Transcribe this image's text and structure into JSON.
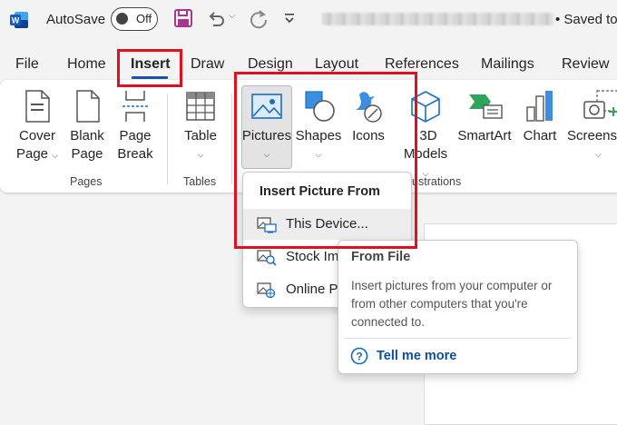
{
  "titlebar": {
    "autosave_label": "AutoSave",
    "toggle_state": "Off",
    "saved_text": "• Saved to"
  },
  "tabs": [
    "File",
    "Home",
    "Insert",
    "Draw",
    "Design",
    "Layout",
    "References",
    "Mailings",
    "Review"
  ],
  "active_tab": "Insert",
  "ribbon": {
    "cover_page": [
      "Cover",
      "Page"
    ],
    "blank_page": [
      "Blank",
      "Page"
    ],
    "page_break": [
      "Page",
      "Break"
    ],
    "table": "Table",
    "pictures": "Pictures",
    "shapes": "Shapes",
    "icons": "Icons",
    "models_3d": [
      "3D",
      "Models"
    ],
    "smartart": "SmartArt",
    "chart": "Chart",
    "screenshot": "Screenshot",
    "groups": {
      "pages": "Pages",
      "tables": "Tables",
      "illustrations": "Illustrations"
    }
  },
  "menu": {
    "title": "Insert Picture From",
    "items": [
      {
        "label": "This Device...",
        "icon": "device-picture-icon"
      },
      {
        "label": "Stock Images...",
        "icon": "stock-images-icon"
      },
      {
        "label": "Online Pictures...",
        "icon": "online-pictures-icon"
      }
    ]
  },
  "tooltip": {
    "title": "From File",
    "body": "Insert pictures from your computer or from other computers that you're connected to.",
    "link": "Tell me more"
  },
  "colors": {
    "accent": "#1a52b3",
    "highlight": "#e0101e",
    "word_blue": "#185abd",
    "save_purple": "#a4398f"
  }
}
